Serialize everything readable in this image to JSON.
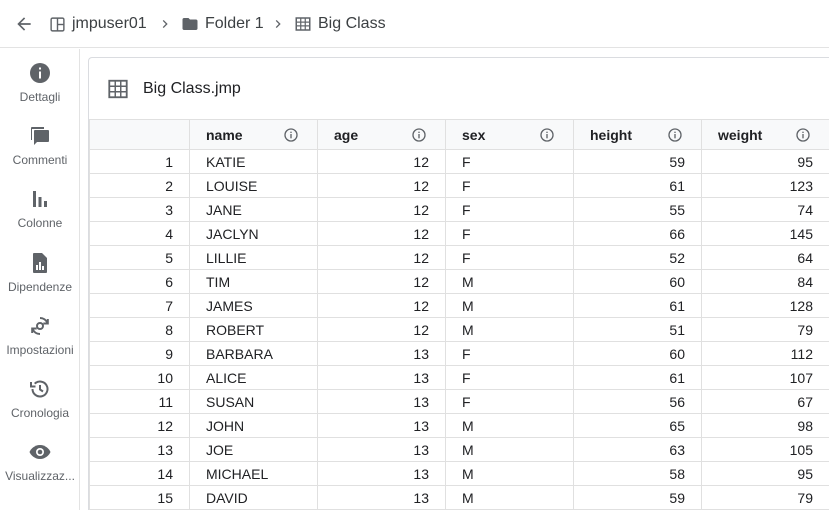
{
  "breadcrumb": {
    "items": [
      {
        "label": "jmpuser01",
        "icon": "space-icon"
      },
      {
        "label": "Folder 1",
        "icon": "folder-icon"
      },
      {
        "label": "Big Class",
        "icon": "table-icon"
      }
    ]
  },
  "sidebar": {
    "items": [
      {
        "label": "Dettagli",
        "icon": "info-icon"
      },
      {
        "label": "Commenti",
        "icon": "comments-icon"
      },
      {
        "label": "Colonne",
        "icon": "columns-chart-icon"
      },
      {
        "label": "Dipendenze",
        "icon": "dependencies-icon"
      },
      {
        "label": "Impostazioni",
        "icon": "settings-sync-icon"
      },
      {
        "label": "Cronologia",
        "icon": "history-icon"
      },
      {
        "label": "Visualizzaz...",
        "icon": "eye-icon"
      }
    ]
  },
  "panel": {
    "title": "Big Class.jmp"
  },
  "table": {
    "columns": [
      "name",
      "age",
      "sex",
      "height",
      "weight"
    ],
    "rows": [
      [
        "1",
        "KATIE",
        "12",
        "F",
        "59",
        "95"
      ],
      [
        "2",
        "LOUISE",
        "12",
        "F",
        "61",
        "123"
      ],
      [
        "3",
        "JANE",
        "12",
        "F",
        "55",
        "74"
      ],
      [
        "4",
        "JACLYN",
        "12",
        "F",
        "66",
        "145"
      ],
      [
        "5",
        "LILLIE",
        "12",
        "F",
        "52",
        "64"
      ],
      [
        "6",
        "TIM",
        "12",
        "M",
        "60",
        "84"
      ],
      [
        "7",
        "JAMES",
        "12",
        "M",
        "61",
        "128"
      ],
      [
        "8",
        "ROBERT",
        "12",
        "M",
        "51",
        "79"
      ],
      [
        "9",
        "BARBARA",
        "13",
        "F",
        "60",
        "112"
      ],
      [
        "10",
        "ALICE",
        "13",
        "F",
        "61",
        "107"
      ],
      [
        "11",
        "SUSAN",
        "13",
        "F",
        "56",
        "67"
      ],
      [
        "12",
        "JOHN",
        "13",
        "M",
        "65",
        "98"
      ],
      [
        "13",
        "JOE",
        "13",
        "M",
        "63",
        "105"
      ],
      [
        "14",
        "MICHAEL",
        "13",
        "M",
        "58",
        "95"
      ],
      [
        "15",
        "DAVID",
        "13",
        "M",
        "59",
        "79"
      ]
    ]
  },
  "colors": {
    "icon": "#5f6368",
    "border": "#e0e0e0",
    "header_bg": "#f8f9fa"
  }
}
